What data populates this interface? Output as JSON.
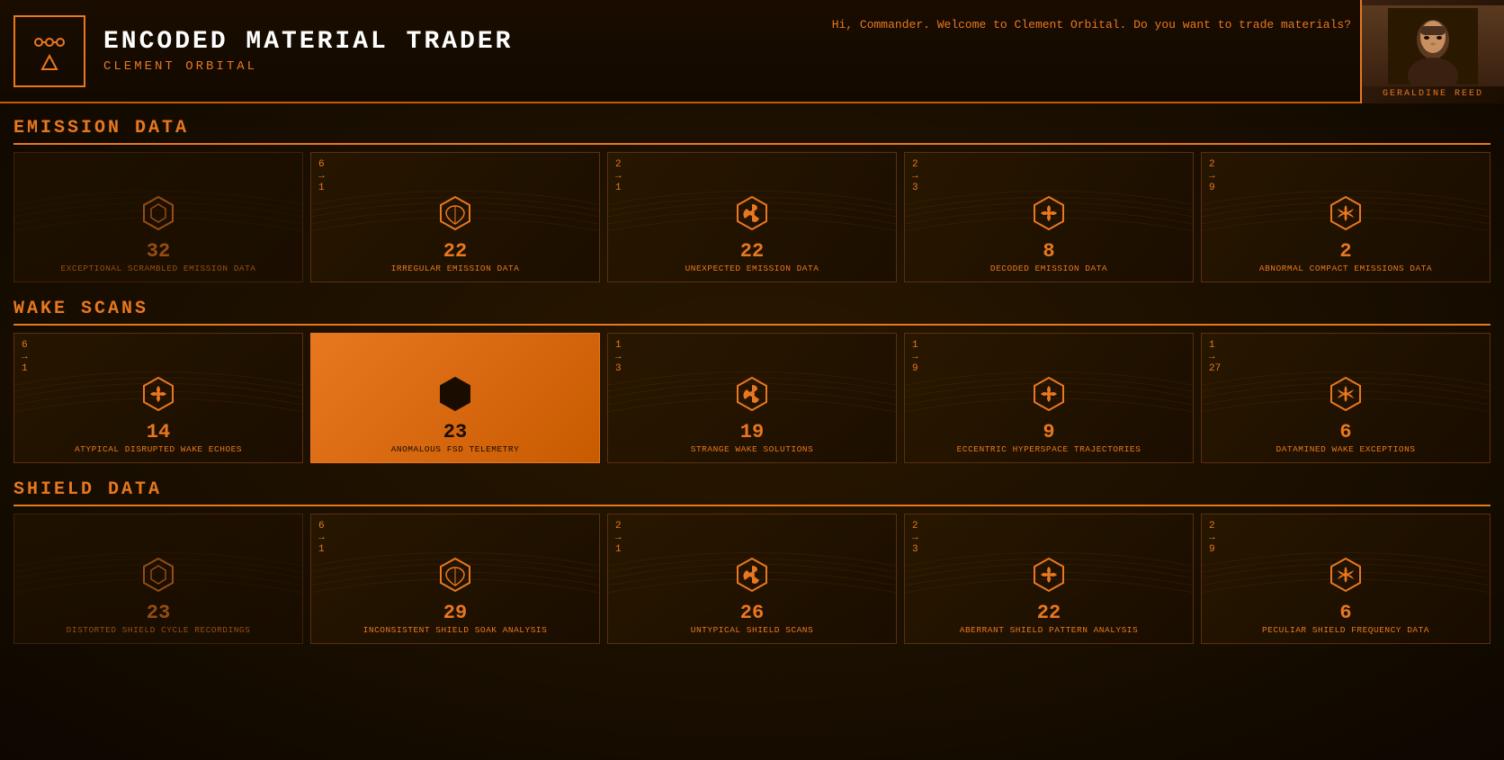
{
  "header": {
    "logo_label": "ENCODED MATERIAL TRADER",
    "location": "CLEMENT ORBITAL",
    "greeting": "Hi, Commander. Welcome to Clement Orbital. Do you want to trade materials?",
    "agent_name": "GERALDINE REED"
  },
  "sections": [
    {
      "id": "emission_data",
      "title": "EMISSION DATA",
      "cards": [
        {
          "id": "exceptional_scrambled",
          "count": "32",
          "label": "EXCEPTIONAL SCRAMBLED\nEMISSION DATA",
          "icon_type": "hex-simple",
          "ratio_from": null,
          "ratio_to": null,
          "active": false,
          "dimmed": true,
          "no_data": false
        },
        {
          "id": "irregular_emission",
          "count": "22",
          "label": "IRREGULAR EMISSION DATA",
          "icon_type": "hex-leaf",
          "ratio_from": "6",
          "ratio_to": "1",
          "active": false,
          "dimmed": false,
          "no_data": false
        },
        {
          "id": "unexpected_emission",
          "count": "22",
          "label": "UNEXPECTED EMISSION\nDATA",
          "icon_type": "hex-tri",
          "ratio_from": "2",
          "ratio_to": "1",
          "active": false,
          "dimmed": false,
          "no_data": false
        },
        {
          "id": "decoded_emission",
          "count": "8",
          "label": "DECODED EMISSION DATA",
          "icon_type": "hex-quad",
          "ratio_from": "2",
          "ratio_to": "3",
          "active": false,
          "dimmed": false,
          "no_data": false
        },
        {
          "id": "abnormal_compact",
          "count": "2",
          "label": "ABNORMAL COMPACT\nEMISSIONS DATA",
          "icon_type": "hex-six",
          "ratio_from": "2",
          "ratio_to": "9",
          "active": false,
          "dimmed": false,
          "no_data": false
        }
      ]
    },
    {
      "id": "wake_scans",
      "title": "WAKE SCANS",
      "cards": [
        {
          "id": "atypical_disrupted",
          "count": "14",
          "label": "ATYPICAL DISRUPTED\nWAKE ECHOES",
          "icon_type": "hex-quad",
          "ratio_from": "6",
          "ratio_to": "1",
          "active": false,
          "dimmed": false,
          "no_data": false
        },
        {
          "id": "anomalous_fsd",
          "count": "23",
          "label": "ANOMALOUS FSD\nTELEMETRY",
          "icon_type": "hex-leaf",
          "ratio_from": null,
          "ratio_to": null,
          "active": true,
          "dimmed": false,
          "no_data": false
        },
        {
          "id": "strange_wake",
          "count": "19",
          "label": "STRANGE WAKE\nSOLUTIONS",
          "icon_type": "hex-tri",
          "ratio_from": "1",
          "ratio_to": "3",
          "active": false,
          "dimmed": false,
          "no_data": false
        },
        {
          "id": "eccentric_hyperspace",
          "count": "9",
          "label": "ECCENTRIC HYPERSPACE\nTRAJECTORIES",
          "icon_type": "hex-quad",
          "ratio_from": "1",
          "ratio_to": "9",
          "active": false,
          "dimmed": false,
          "no_data": false
        },
        {
          "id": "datamined_wake",
          "count": "6",
          "label": "DATAMINED WAKE\nEXCEPTIONS",
          "icon_type": "hex-six",
          "ratio_from": "1",
          "ratio_to": "27",
          "active": false,
          "dimmed": false,
          "no_data": false
        }
      ]
    },
    {
      "id": "shield_data",
      "title": "SHIELD DATA",
      "cards": [
        {
          "id": "distorted_shield",
          "count": "23",
          "label": "DISTORTED SHIELD CYCLE\nRECORDINGS",
          "icon_type": "hex-simple",
          "ratio_from": null,
          "ratio_to": null,
          "active": false,
          "dimmed": true,
          "no_data": false
        },
        {
          "id": "inconsistent_shield",
          "count": "29",
          "label": "INCONSISTENT SHIELD\nSOAK ANALYSIS",
          "icon_type": "hex-leaf",
          "ratio_from": "6",
          "ratio_to": "1",
          "active": false,
          "dimmed": false,
          "no_data": false
        },
        {
          "id": "untypical_shield",
          "count": "26",
          "label": "UNTYPICAL SHIELD SCANS",
          "icon_type": "hex-tri",
          "ratio_from": "2",
          "ratio_to": "1",
          "active": false,
          "dimmed": false,
          "no_data": false
        },
        {
          "id": "aberrant_shield",
          "count": "22",
          "label": "ABERRANT SHIELD\nPATTERN ANALYSIS",
          "icon_type": "hex-quad",
          "ratio_from": "2",
          "ratio_to": "3",
          "active": false,
          "dimmed": false,
          "no_data": false
        },
        {
          "id": "peculiar_shield",
          "count": "6",
          "label": "PECULIAR SHIELD\nFREQUENCY DATA",
          "icon_type": "hex-six",
          "ratio_from": "2",
          "ratio_to": "9",
          "active": false,
          "dimmed": false,
          "no_data": false
        }
      ]
    }
  ],
  "icons": {
    "hex-simple": "⬡",
    "hex-leaf": "◈",
    "hex-tri": "⬡",
    "hex-quad": "✦",
    "hex-six": "✿"
  }
}
